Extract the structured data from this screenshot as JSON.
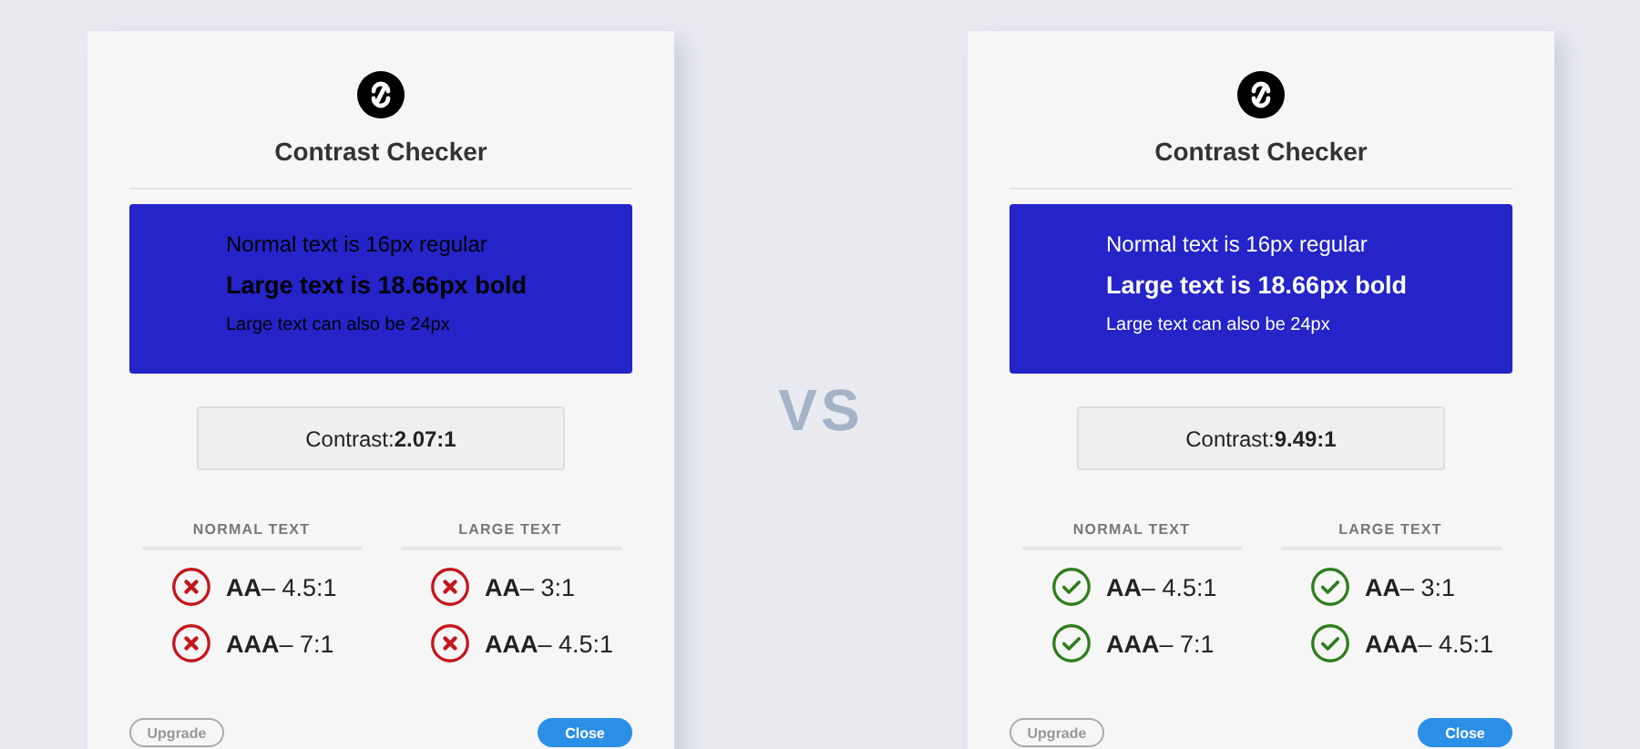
{
  "panels": [
    {
      "title": "Contrast Checker",
      "sample": {
        "color": "#000000",
        "lines": [
          "Normal text is 16px regular",
          "Large text is 18.66px bold",
          "Large text can also be 24px"
        ]
      },
      "contrast": "Contrast:**2.07:1**",
      "columns": [
        {
          "heading": "NORMAL TEXT",
          "criteria": [
            {
              "label": "**AA**– 4.5:1",
              "passed": false
            },
            {
              "label": "**AAA**– 7:1",
              "passed": false
            }
          ]
        },
        {
          "heading": "LARGE TEXT",
          "criteria": [
            {
              "label": "**AA**– 3:1",
              "passed": false
            },
            {
              "label": "**AAA**– 4.5:1",
              "passed": false
            }
          ]
        }
      ],
      "buttons": {
        "secondary": "Upgrade",
        "primary": "Close"
      }
    },
    {
      "title": "Contrast Checker",
      "sample": {
        "color": "#ffffff",
        "lines": [
          "Normal text is 16px regular",
          "Large text is 18.66px bold",
          "Large text can also be 24px"
        ]
      },
      "contrast": "Contrast:**9.49:1**",
      "columns": [
        {
          "heading": "NORMAL TEXT",
          "criteria": [
            {
              "label": "**AA**– 4.5:1",
              "passed": true
            },
            {
              "label": "**AAA**– 7:1",
              "passed": true
            }
          ]
        },
        {
          "heading": "LARGE TEXT",
          "criteria": [
            {
              "label": "**AA**– 3:1",
              "passed": true
            },
            {
              "label": "**AAA**– 4.5:1",
              "passed": true
            }
          ]
        }
      ],
      "buttons": {
        "secondary": "Upgrade",
        "primary": "Close"
      }
    }
  ],
  "separator": "VS"
}
